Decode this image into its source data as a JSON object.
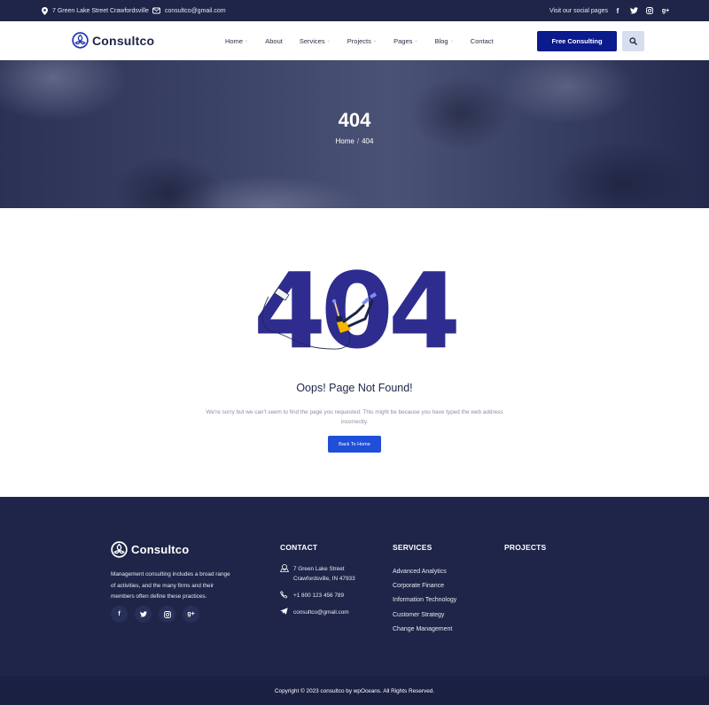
{
  "topbar": {
    "address": "7 Green Lake Street Crawfordsville",
    "email": "consultco@gmail.com",
    "social_label": "Visit our social pages",
    "social_icons": [
      "facebook-icon",
      "twitter-icon",
      "instagram-icon",
      "google-plus-icon"
    ]
  },
  "header": {
    "logo": "Consultco",
    "nav": [
      {
        "label": "Home",
        "dropdown": true
      },
      {
        "label": "About",
        "dropdown": false
      },
      {
        "label": "Services",
        "dropdown": true
      },
      {
        "label": "Projects",
        "dropdown": true
      },
      {
        "label": "Pages",
        "dropdown": true
      },
      {
        "label": "Blog",
        "dropdown": true
      },
      {
        "label": "Contact",
        "dropdown": false
      }
    ],
    "cta_label": "Free Consulting",
    "search_icon": "search-icon"
  },
  "hero": {
    "title": "404",
    "breadcrumb_home": "Home",
    "breadcrumb_sep": "/",
    "breadcrumb_current": "404"
  },
  "error": {
    "illustration_text": "404",
    "title": "Oops! Page Not Found!",
    "message": "We're sorry but we can't seem to find the page you requested. This might be because you have typed the web address incorrectly.",
    "button_label": "Back To Home"
  },
  "footer": {
    "logo": "Consultco",
    "description": "Management consulting includes a broad range of activities, and the many firms and their members often define these practices.",
    "contact_heading": "CONTACT",
    "address_line1": "7 Green Lake Street",
    "address_line2": "Crawfordsville, IN 47933",
    "phone": "+1 800 123 456 789",
    "email": "consultco@gmail.com",
    "services_heading": "SERVICES",
    "services": [
      "Advanced Analytics",
      "Corporate Finance",
      "Information Technology",
      "Customer Strategy",
      "Change Management"
    ],
    "projects_heading": "PROJECTS",
    "copyright": "Copyright © 2023 consultco by wpOceans. All Rights Reserved."
  },
  "colors": {
    "navy": "#1e2548",
    "brand_blue": "#0b1a8c",
    "illustration_blue": "#2e2d8f",
    "button_blue": "#1f4fd8"
  }
}
